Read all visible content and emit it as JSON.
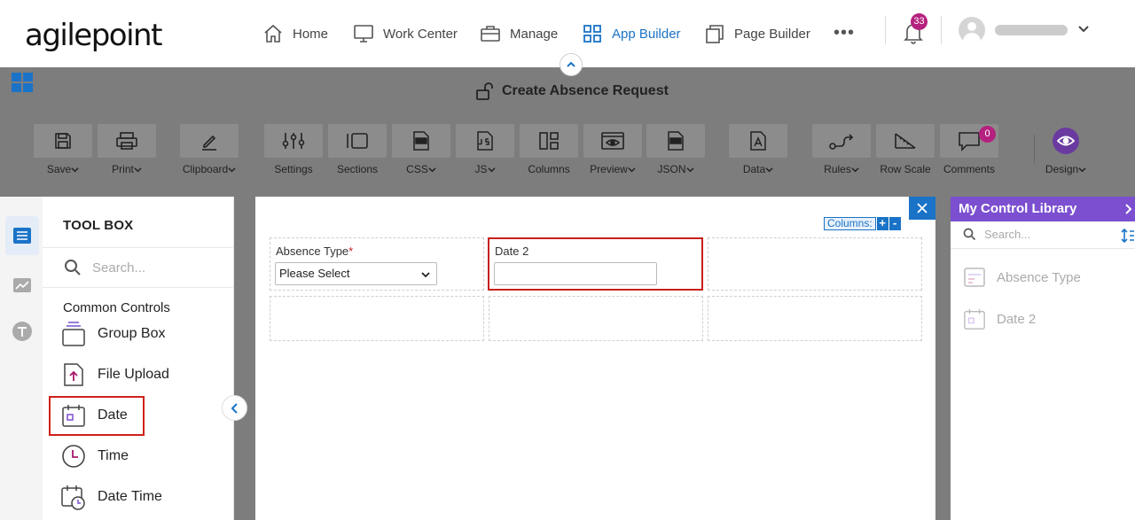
{
  "app": {
    "logo_text": "agilepoint",
    "nav": [
      {
        "label": "Home",
        "icon": "home-icon",
        "active": false
      },
      {
        "label": "Work Center",
        "icon": "monitor-icon",
        "active": false
      },
      {
        "label": "Manage",
        "icon": "briefcase-icon",
        "active": false
      },
      {
        "label": "App Builder",
        "icon": "app-grid-icon",
        "active": true
      },
      {
        "label": "Page Builder",
        "icon": "pages-icon",
        "active": false
      }
    ],
    "more_label": "•••",
    "notifications_count": "33"
  },
  "form": {
    "title": "Create Absence Request"
  },
  "toolbar": [
    {
      "label": "Save",
      "dropdown": true,
      "icon": "save-icon"
    },
    {
      "label": "Print",
      "dropdown": true,
      "icon": "print-icon"
    },
    {
      "label": "Clipboard",
      "dropdown": true,
      "icon": "pencil-icon"
    },
    {
      "label": "Settings",
      "dropdown": false,
      "icon": "sliders-icon"
    },
    {
      "label": "Sections",
      "dropdown": false,
      "icon": "sections-icon"
    },
    {
      "label": "CSS",
      "dropdown": true,
      "icon": "css-file-icon"
    },
    {
      "label": "JS",
      "dropdown": true,
      "icon": "js-file-icon"
    },
    {
      "label": "Columns",
      "dropdown": false,
      "icon": "columns-icon"
    },
    {
      "label": "Preview",
      "dropdown": true,
      "icon": "preview-eye-icon"
    },
    {
      "label": "JSON",
      "dropdown": true,
      "icon": "json-file-icon"
    },
    {
      "label": "Data",
      "dropdown": true,
      "icon": "data-icon"
    },
    {
      "label": "Rules",
      "dropdown": true,
      "icon": "rules-icon"
    },
    {
      "label": "Row Scale",
      "dropdown": false,
      "icon": "row-scale-icon"
    },
    {
      "label": "Comments",
      "dropdown": false,
      "icon": "comment-icon",
      "badge": "0"
    },
    {
      "label": "Design",
      "dropdown": true,
      "icon": "design-eye-icon"
    }
  ],
  "toolbox": {
    "title": "TOOL BOX",
    "search_placeholder": "Search...",
    "section": "Common Controls",
    "items": [
      {
        "label": "Group Box",
        "icon": "group-box-icon"
      },
      {
        "label": "File Upload",
        "icon": "file-upload-icon"
      },
      {
        "label": "Date",
        "icon": "date-icon"
      },
      {
        "label": "Time",
        "icon": "clock-icon"
      },
      {
        "label": "Date Time",
        "icon": "date-time-icon"
      }
    ]
  },
  "canvas": {
    "columns_label": "Columns:",
    "plus": "+",
    "minus": "-",
    "fields": {
      "absence_type_label": "Absence Type",
      "required_mark": "*",
      "absence_type_value": "Please Select",
      "date2_label": "Date 2"
    }
  },
  "library": {
    "title": "My Control Library",
    "search_placeholder": "Search...",
    "items": [
      {
        "label": "Absence Type",
        "icon": "dropdown-control-icon"
      },
      {
        "label": "Date 2",
        "icon": "date-control-icon"
      }
    ]
  },
  "colors": {
    "accent": "#1a73c7",
    "badge": "#b5217e",
    "library_header": "#7b4fd0",
    "highlight": "#d0201a"
  }
}
